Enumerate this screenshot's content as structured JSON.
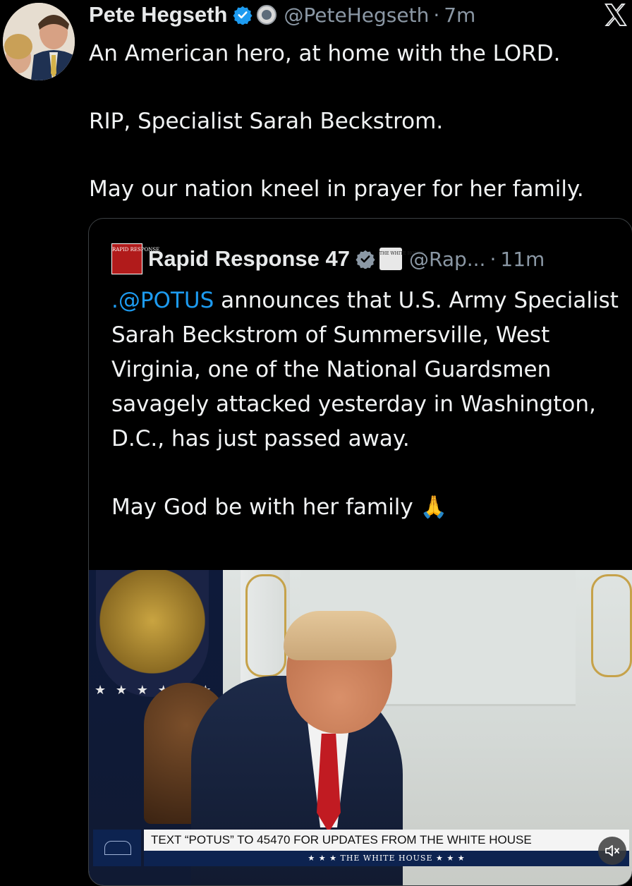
{
  "tweet": {
    "author_name": "Pete Hegseth",
    "handle": "@PeteHegseth",
    "separator": "·",
    "time": "7m",
    "lines": [
      "An American hero, at home with the LORD.",
      "RIP, Specialist Sarah Beckstrom.",
      "May our nation kneel in prayer for her family."
    ]
  },
  "quote": {
    "author_name": "Rapid Response 47",
    "avatar_text": "RAPID RESPONSE",
    "affiliation_text": "THE WHITE HOUSE",
    "handle": "@Rap...",
    "separator": "·",
    "time": "11m",
    "mention": ".@POTUS",
    "body": " announces that U.S. Army Specialist Sarah Beckstrom of Summersville, West Virginia, one of the National Guardsmen savagely attacked yesterday in Washington, D.C., has just passed away.",
    "closing": "May God be with her family",
    "emoji": "🙏"
  },
  "video": {
    "banner_text": "TEXT “POTUS” TO 45470 FOR UPDATES FROM THE WHITE HOUSE",
    "banner_subtext": "★ ★ ★  THE WHITE HOUSE  ★ ★ ★",
    "mute_icon": "speaker-muted-icon"
  },
  "colors": {
    "background": "#000000",
    "text": "#e7e9ea",
    "secondary": "#8b98a5",
    "link": "#1d9bf0",
    "verified": "#1d9bf0"
  }
}
